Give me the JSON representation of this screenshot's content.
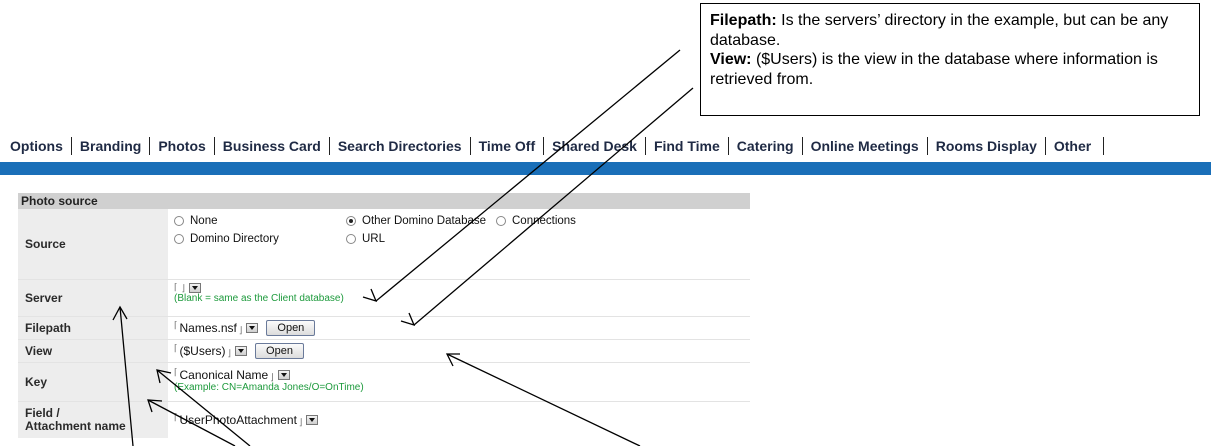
{
  "callout": {
    "filepath_label": "Filepath:",
    "filepath_text": " Is the servers’ directory in the example, but can be any database.",
    "view_label": "View:",
    "view_text": " ($Users) is the view in the database where information is retrieved from."
  },
  "tabs": [
    {
      "label": "Options"
    },
    {
      "label": "Branding"
    },
    {
      "label": "Photos"
    },
    {
      "label": "Business Card"
    },
    {
      "label": "Search Directories"
    },
    {
      "label": "Time Off"
    },
    {
      "label": "Shared Desk"
    },
    {
      "label": "Find Time"
    },
    {
      "label": "Catering"
    },
    {
      "label": "Online Meetings"
    },
    {
      "label": "Rooms Display"
    },
    {
      "label": "Other"
    }
  ],
  "form": {
    "section_title": "Photo source",
    "source": {
      "label": "Source",
      "options": {
        "none": "None",
        "other_domino": "Other Domino Database",
        "connections": "Connections",
        "domino_directory": "Domino Directory",
        "url": "URL"
      },
      "selected": "Other Domino Database"
    },
    "server": {
      "label": "Server",
      "value": "",
      "hint": "(Blank = same as the Client database)"
    },
    "filepath": {
      "label": "Filepath",
      "value": "Names.nsf",
      "button": "Open"
    },
    "view": {
      "label": "View",
      "value": "($Users)",
      "button": "Open"
    },
    "key": {
      "label": "Key",
      "value": "Canonical Name",
      "hint": "(Example: CN=Amanda Jones/O=OnTime)"
    },
    "field": {
      "label": "Field /\nAttachment name",
      "value": "UserPhotoAttachment"
    }
  },
  "colors": {
    "blue_bar": "#1a6fb8",
    "hint_green": "#1d9a3c",
    "label_bg": "#ededed",
    "section_bg": "#d0d0d0"
  }
}
